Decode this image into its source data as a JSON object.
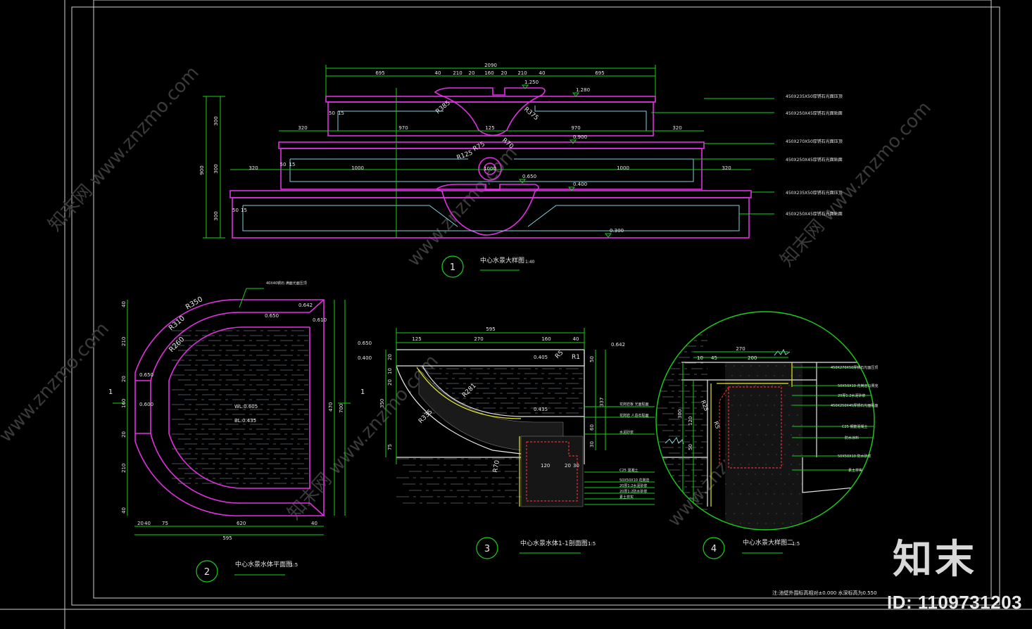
{
  "colors": {
    "magenta": "#e030e0",
    "green": "#19d119",
    "white": "#e6e6e6",
    "cyan": "#7fd0e0",
    "red": "#e03030",
    "yellow": "#e6e62a",
    "frame": "#cfcfcf",
    "watermark": "#3a3a3a"
  },
  "watermark": {
    "text": "www.znzmo.com",
    "logo": "知末网"
  },
  "drawing1": {
    "num": "1",
    "title": "中心水景大样图",
    "scale": "1:40",
    "top_dims": [
      "2090"
    ],
    "top_segments": [
      "695",
      "40",
      "210",
      "20",
      "160",
      "20",
      "210",
      "40",
      "695"
    ],
    "level_labels": [
      "1.250",
      "1.280",
      "0.900",
      "0.650",
      "0.400",
      "0.300"
    ],
    "second_dims": [
      "320",
      "970",
      "125",
      "970",
      "320"
    ],
    "third_dims": [
      "320",
      "50",
      "15",
      "1000",
      "1000",
      "1000",
      "320"
    ],
    "left_dims": [
      "900",
      "300",
      "300",
      "300"
    ],
    "radius_labels": [
      "R385",
      "R375",
      "R75",
      "R125",
      "R70"
    ],
    "small_marks": [
      "50",
      "15"
    ],
    "notes": [
      "450X235X50厚锈石光面压顶",
      "450X250X45厚锈石光面贴面",
      "450X270X50厚锈石光面压顶",
      "450X250X45厚锈石光面贴面",
      "450X235X50厚锈石光面压顶",
      "450X250X45厚锈石光面贴面"
    ]
  },
  "drawing2": {
    "num": "2",
    "title": "中心水景水体平面图",
    "scale": "1:5",
    "radii": [
      "R350",
      "R310",
      "R260"
    ],
    "levels": [
      "0.642",
      "0.650",
      "0.610",
      "0.650",
      "0.600"
    ],
    "water": [
      "WL:0.605",
      "BL:0.435"
    ],
    "bottom_dims": [
      "20",
      "40",
      "75",
      "620",
      "40"
    ],
    "total": "595",
    "right_dims": [
      "470",
      "700"
    ],
    "left_dims": [
      "40",
      "210",
      "20",
      "160",
      "20",
      "210",
      "40"
    ],
    "section_mark": "1",
    "note": "40X40锈石 满面光面压顶"
  },
  "drawing3": {
    "num": "3",
    "title": "中心水景水体1-1剖面图",
    "scale": "1:5",
    "top_dims": [
      "595"
    ],
    "segments": [
      "125",
      "270",
      "160",
      "40"
    ],
    "levels": [
      "0.650",
      "0.400",
      "0.642",
      "0.405",
      "0.435"
    ],
    "radii": [
      "R281",
      "R335",
      "R70",
      "R5",
      "R1"
    ],
    "bottom_dims": [
      "120",
      "20",
      "30"
    ],
    "left_dims": [
      "20",
      "10",
      "20",
      "350",
      "75"
    ],
    "right_dims": [
      "50",
      "337",
      "60",
      "30"
    ],
    "notes": [
      "花岗岩板 光面贴面",
      "花岗岩 人造石贴面",
      "水泥砂浆",
      "C25 混凝土",
      "50X50X10 花岗岩",
      "20厚1:2水泥砂浆",
      "20厚1:2防水砂浆",
      "素土夯实"
    ]
  },
  "drawing4": {
    "num": "4",
    "title": "中心水景大样图二",
    "scale": "1:5",
    "top_dims": [
      "270",
      "10",
      "45",
      "200"
    ],
    "radii": [
      "R25",
      "R5"
    ],
    "left_dims": [
      "300",
      "120",
      "50"
    ],
    "notes": [
      "450X270X50厚锈石光面压顶",
      "50X50X10 花岗岩马赛克",
      "20厚1:2水泥砂浆",
      "450X250X45厚锈石光面贴面",
      "C25 钢筋混凝土",
      "防水涂料",
      "50X50X10 防水砂浆",
      "素土夯实"
    ]
  },
  "footer_note": "注:池壁外围标高相对±0.000 水深标高为0.550",
  "brand": "知末",
  "id_label": "ID: 1109731203"
}
